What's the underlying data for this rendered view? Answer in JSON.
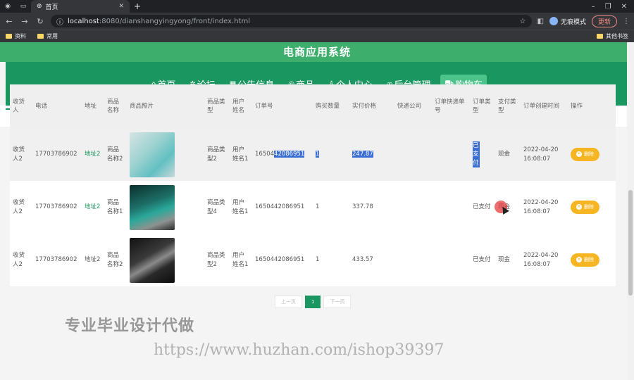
{
  "browser": {
    "tab_title": "首页",
    "url_host": "localhost",
    "url_path": ":8080/dianshangyingyong/front/index.html",
    "profile_label": "无痕模式",
    "update_label": "更新",
    "bookmarks": [
      "资料",
      "常用"
    ],
    "other_bookmarks": "其他书签"
  },
  "site": {
    "title": "电商应用系统",
    "nav": [
      {
        "icon": "home-icon",
        "label": "首页"
      },
      {
        "icon": "forum-icon",
        "label": "论坛"
      },
      {
        "icon": "notice-icon",
        "label": "公告信息"
      },
      {
        "icon": "goods-icon",
        "label": "商品"
      },
      {
        "icon": "user-icon",
        "label": "个人中心"
      },
      {
        "icon": "link-icon",
        "label": "后台管理"
      },
      {
        "icon": "cart-icon",
        "label": "购物车"
      }
    ]
  },
  "table": {
    "headers": [
      "收货人",
      "电话",
      "地址",
      "商品名称",
      "商品照片",
      "商品类型",
      "用户姓名",
      "订单号",
      "购买数量",
      "实付价格",
      "快递公司",
      "订单快递单号",
      "订单类型",
      "支付类型",
      "订单创建时间",
      "操作"
    ],
    "rows": [
      {
        "receiver": "收货人2",
        "phone": "17703786902",
        "address": "地址2",
        "product": "商品名称2",
        "ptype": "商品类型2",
        "user": "用户姓名1",
        "order_prefix": "16504",
        "order_rest": "42086951",
        "qty": "1",
        "price": "247.87",
        "courier": "",
        "tracking": "",
        "status": "已支付",
        "pay": "现金",
        "time": "2022-04-20 16:08:07",
        "action": "删除"
      },
      {
        "receiver": "收货人2",
        "phone": "17703786902",
        "address": "地址2",
        "product": "商品名称1",
        "ptype": "商品类型4",
        "user": "用户姓名1",
        "order_prefix": "1650442086951",
        "order_rest": "",
        "qty": "1",
        "price": "337.78",
        "courier": "",
        "tracking": "",
        "status": "已支付",
        "pay": "现金",
        "time": "2022-04-20 16:08:07",
        "action": "删除"
      },
      {
        "receiver": "收货人2",
        "phone": "17703786902",
        "address": "地址2",
        "product": "商品名称2",
        "ptype": "商品类型2",
        "user": "用户姓名1",
        "order_prefix": "1650442086951",
        "order_rest": "",
        "qty": "1",
        "price": "433.57",
        "courier": "",
        "tracking": "",
        "status": "已支付",
        "pay": "现金",
        "time": "2022-04-20 16:08:07",
        "action": "删除"
      }
    ]
  },
  "pager": {
    "prev": "上一页",
    "current": "1",
    "next": "下一页"
  },
  "watermark": {
    "line1": "专业毕业设计代做",
    "line2": "https://www.huzhan.com/ishop39397"
  },
  "colors": {
    "brand": "#1a9660",
    "title_bar": "#3dae6c",
    "delete_button": "#f6b623"
  }
}
